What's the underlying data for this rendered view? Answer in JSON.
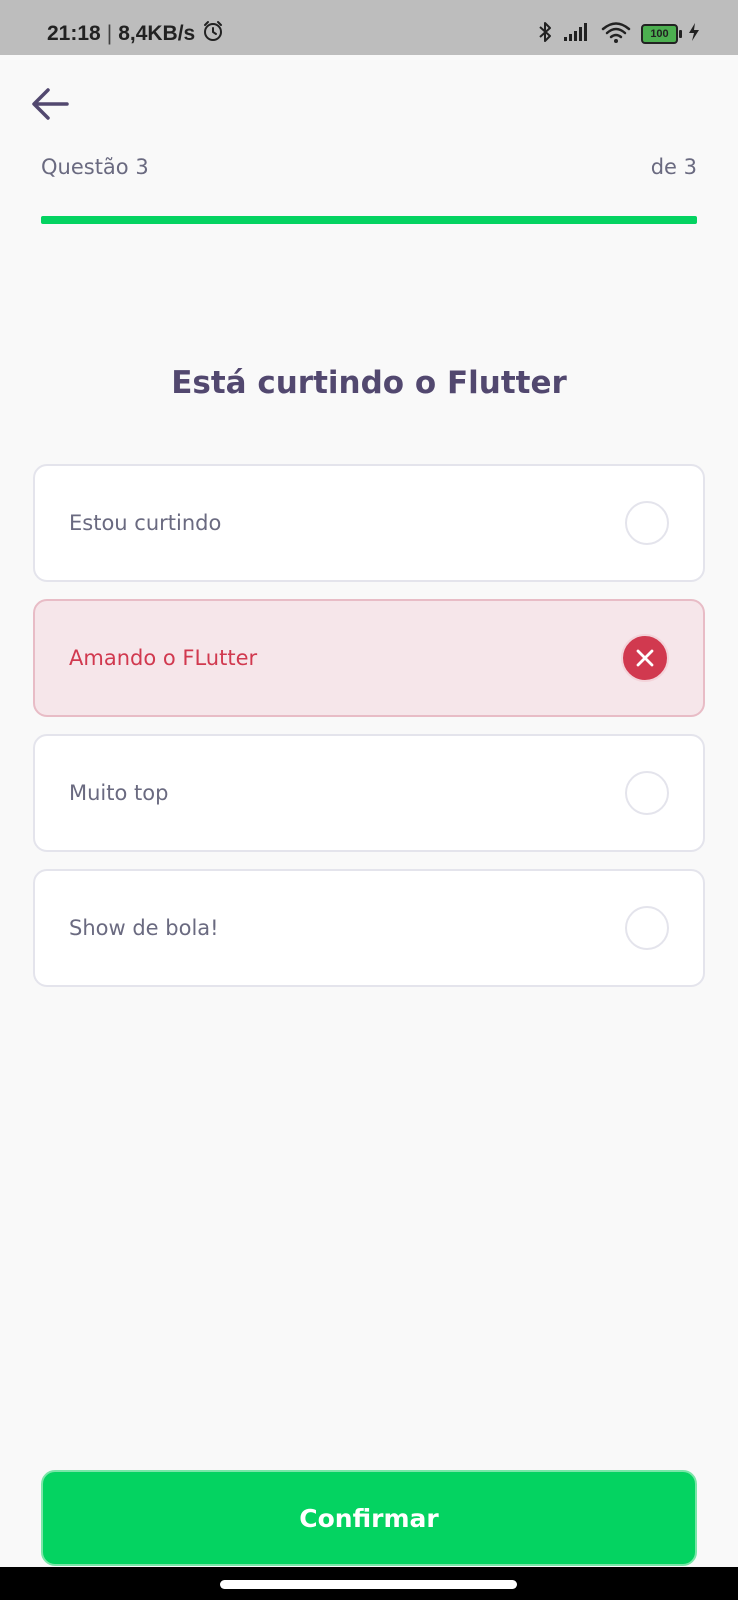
{
  "status_bar": {
    "time": "21:18",
    "separator": "|",
    "network_speed": "8,4KB/s",
    "battery_level": "100",
    "icons": [
      "alarm-icon",
      "bluetooth-icon",
      "signal-icon",
      "wifi-icon",
      "battery-icon",
      "charging-icon"
    ]
  },
  "header": {
    "back_icon": "arrow-left-icon"
  },
  "progress": {
    "question_label": "Questão 3",
    "total_label": "de 3",
    "fraction": 1.0,
    "color": "#04d361"
  },
  "question": {
    "title": "Está curtindo o Flutter"
  },
  "answers": [
    {
      "label": "Estou curtindo",
      "state": "unselected"
    },
    {
      "label": "Amando o FLutter",
      "state": "wrong",
      "icon": "close-icon"
    },
    {
      "label": "Muito top",
      "state": "unselected"
    },
    {
      "label": "Show de bola!",
      "state": "unselected"
    }
  ],
  "colors": {
    "accent": "#04d361",
    "wrong": "#d1394f",
    "wrong_bg": "#f6e6ea",
    "text": "#52486f"
  },
  "confirm": {
    "label": "Confirmar"
  }
}
